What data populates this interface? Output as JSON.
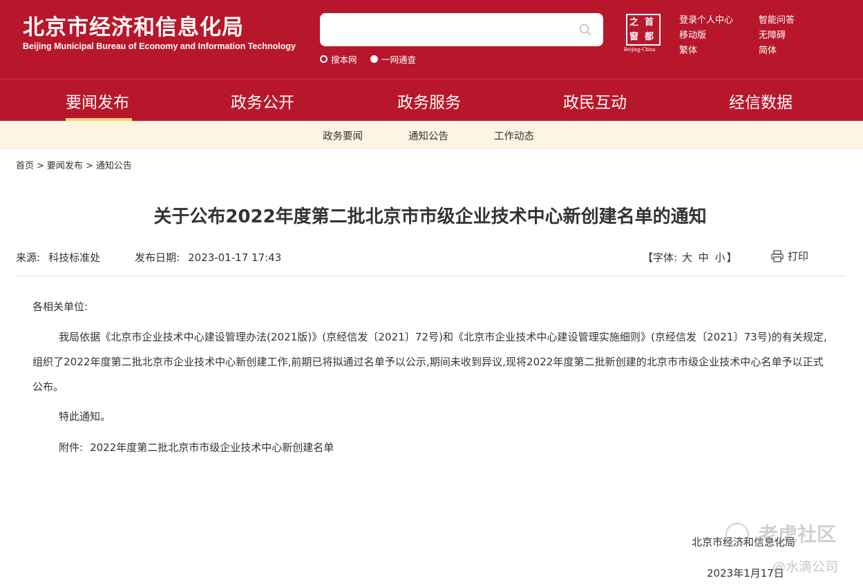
{
  "header": {
    "logo_cn": "北京市经济和信息化局",
    "logo_en": "Beijing Municipal Bureau of Economy and Information Technology",
    "search": {
      "placeholder": "",
      "value": ""
    },
    "scope_options": [
      "搜本网",
      "一网通查"
    ],
    "emblem_chars": [
      "之",
      "首",
      "窗",
      "都"
    ],
    "emblem_caption": "Beijing-China",
    "links": [
      "登录个人中心",
      "智能问答",
      "移动版",
      "无障碍",
      "繁体",
      "简体"
    ]
  },
  "main_nav": [
    "要闻发布",
    "政务公开",
    "政务服务",
    "政民互动",
    "经信数据"
  ],
  "sub_nav": [
    "政务要闻",
    "通知公告",
    "工作动态"
  ],
  "breadcrumb": [
    "首页",
    "要闻发布",
    "通知公告"
  ],
  "breadcrumb_sep": ">",
  "article": {
    "title": "关于公布2022年度第二批北京市市级企业技术中心新创建名单的通知",
    "source_label": "来源:",
    "source": "科技标准处",
    "date_label": "发布日期:",
    "date": "2023-01-17 17:43",
    "font_label_open": "【字体:",
    "font_sizes": [
      "大",
      "中",
      "小"
    ],
    "font_label_close": "】",
    "print_label": "打印",
    "salutation": "各相关单位:",
    "paragraph": "我局依据《北京市企业技术中心建设管理办法(2021版)》(京经信发〔2021〕72号)和《北京市企业技术中心建设管理实施细则》(京经信发〔2021〕73号)的有关规定,组织了2022年度第二批北京市企业技术中心新创建工作,前期已将拟通过名单予以公示,期间未收到异议,现将2022年度第二批新创建的北京市市级企业技术中心名单予以正式公布。",
    "notice": "特此通知。",
    "attachment_label": "附件:",
    "attachment_link": "2022年度第二批北京市市级企业技术中心新创建名单",
    "signature": "北京市经济和信息化局",
    "sign_date": "2023年1月17日"
  },
  "watermark": {
    "line1": "老虎社区",
    "line2": "@水滴公司"
  },
  "colors": {
    "brand_red": "#b8172b",
    "subnav_bg": "#fdf4e3",
    "active_bar": "#f2d67a"
  }
}
